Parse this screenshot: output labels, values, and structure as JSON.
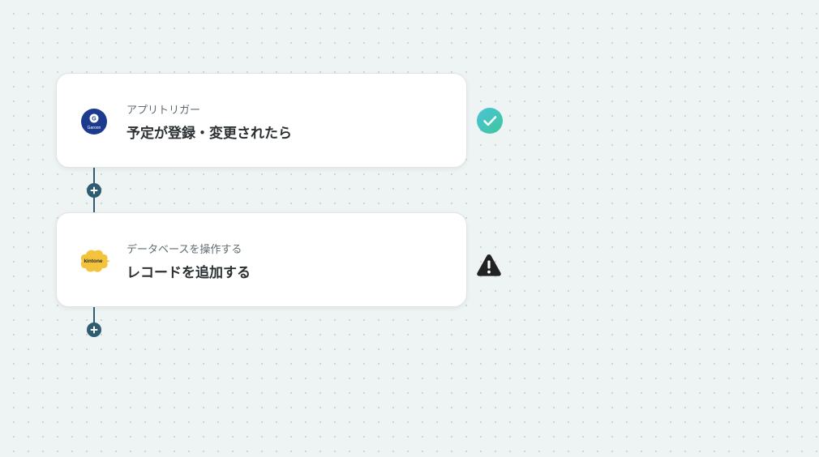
{
  "flow": {
    "steps": [
      {
        "category": "アプリトリガー",
        "title": "予定が登録・変更されたら",
        "app_icon": "garoon-icon",
        "app_logo_text": "Garoon",
        "status": "success",
        "status_icon": "check-circle-icon"
      },
      {
        "category": "データベースを操作する",
        "title": "レコードを追加する",
        "app_icon": "kintone-icon",
        "app_logo_text": "kintone",
        "status": "warning",
        "status_icon": "warning-triangle-icon"
      }
    ]
  },
  "colors": {
    "background": "#eef3f3",
    "connector": "#2e5c70",
    "success_start": "#4bc3d9",
    "success_end": "#3ec79a",
    "warning": "#222222",
    "garoon_blue": "#1c3b8f",
    "kintone_yellow": "#f4c33d"
  }
}
